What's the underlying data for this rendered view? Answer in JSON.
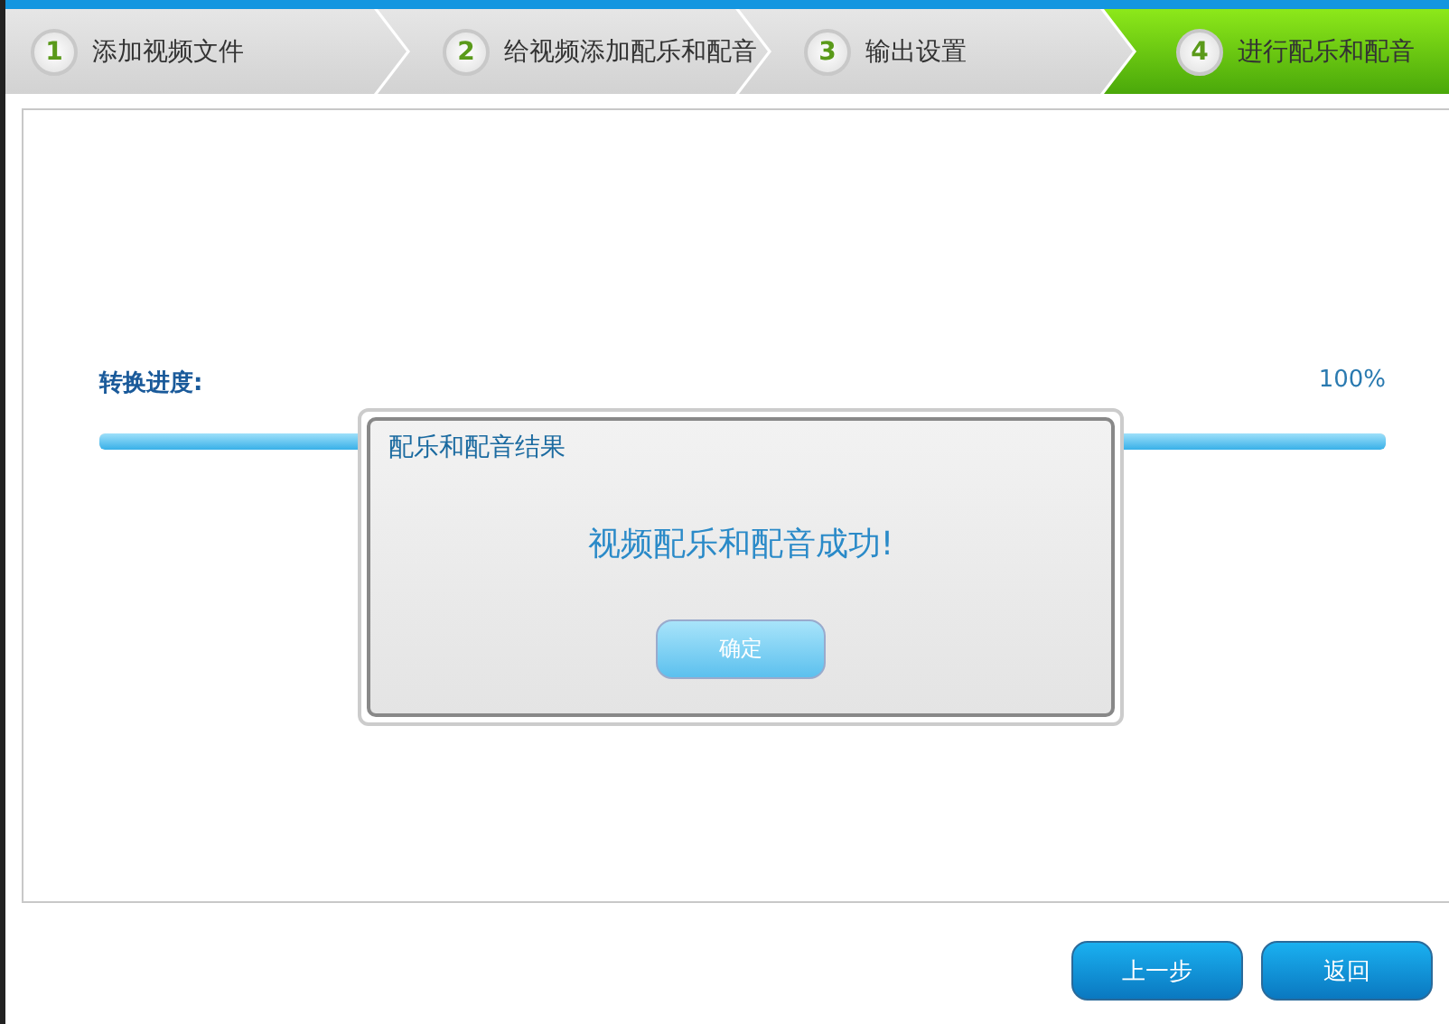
{
  "steps": [
    {
      "number": "1",
      "label": "添加视频文件",
      "selected": false
    },
    {
      "number": "2",
      "label": "给视频添加配乐和配音",
      "selected": false
    },
    {
      "number": "3",
      "label": "输出设置",
      "selected": false
    },
    {
      "number": "4",
      "label": "进行配乐和配音",
      "selected": true
    }
  ],
  "progress": {
    "label": "转换进度:",
    "reading": "100%",
    "level": 1
  },
  "dialog": {
    "title": "配乐和配音结果",
    "message": "视频配乐和配音成功!",
    "button": "确定"
  },
  "buttons": [
    "上一步",
    "返回"
  ]
}
